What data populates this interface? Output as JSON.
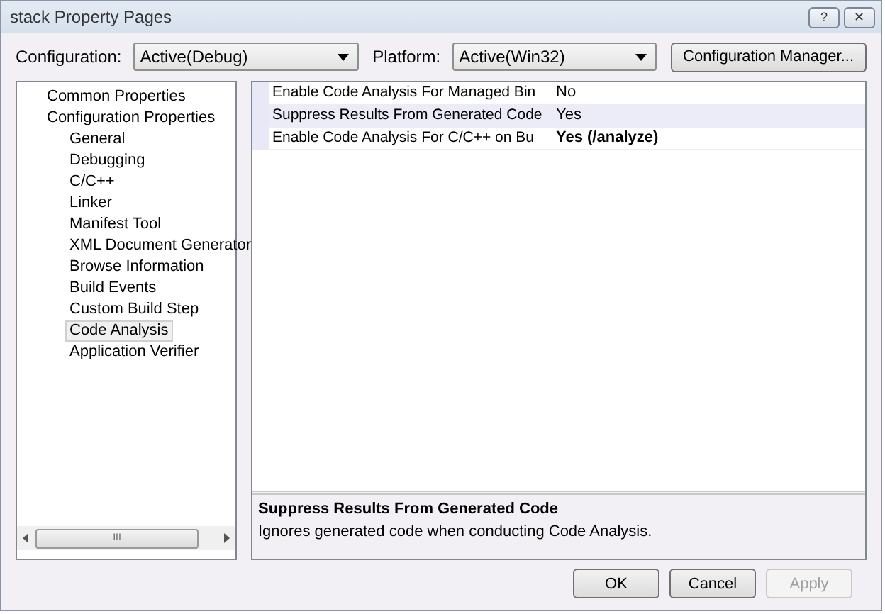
{
  "window": {
    "title": "stack Property Pages",
    "help_button": "?",
    "close_button": "✕"
  },
  "toolbar": {
    "configuration_label": "Configuration:",
    "configuration": "Active(Debug)",
    "platform_label": "Platform:",
    "platform": "Active(Win32)",
    "manager_button": "Configuration Manager..."
  },
  "tree": [
    {
      "label": "Common Properties",
      "selected": false
    },
    {
      "label": "Configuration Properties",
      "selected": false,
      "children": [
        {
          "label": "General",
          "selected": false
        },
        {
          "label": "Debugging",
          "selected": false
        },
        {
          "label": "C/C++",
          "selected": false
        },
        {
          "label": "Linker",
          "selected": false
        },
        {
          "label": "Manifest Tool",
          "selected": false
        },
        {
          "label": "XML Document Generator",
          "selected": false
        },
        {
          "label": "Browse Information",
          "selected": false
        },
        {
          "label": "Build Events",
          "selected": false
        },
        {
          "label": "Custom Build Step",
          "selected": false
        },
        {
          "label": "Code Analysis",
          "selected": true
        },
        {
          "label": "Application Verifier",
          "selected": false
        }
      ]
    }
  ],
  "tree_scrollbar": {
    "grip": "III"
  },
  "properties": [
    {
      "name": "Enable Code Analysis For Managed Bin",
      "value": "No",
      "modified": false,
      "selected": false
    },
    {
      "name": "Suppress Results From Generated Code",
      "value": "Yes",
      "modified": false,
      "selected": true
    },
    {
      "name": "Enable Code Analysis For C/C++ on Bu",
      "value": "Yes (/analyze)",
      "modified": true,
      "selected": false
    }
  ],
  "description": {
    "title": "Suppress Results From Generated Code",
    "text": "Ignores generated code when conducting Code Analysis."
  },
  "buttons": [
    {
      "label": "OK",
      "disabled": false
    },
    {
      "label": "Cancel",
      "disabled": false
    },
    {
      "label": "Apply",
      "disabled": true
    }
  ]
}
